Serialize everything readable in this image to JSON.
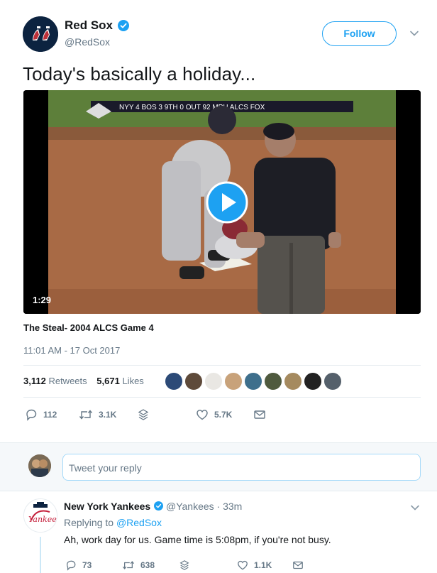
{
  "account": {
    "display_name": "Red Sox",
    "handle": "@RedSox",
    "follow_label": "Follow"
  },
  "tweet": {
    "text": "Today's basically a holiday...",
    "video": {
      "duration": "1:29",
      "scorebug": "NYY 4 BOS 3 9TH 0 OUT 92 MPH ALCS FOX",
      "title": "The Steal- 2004 ALCS Game 4"
    },
    "timestamp": "11:01 AM - 17 Oct 2017",
    "stats": {
      "retweets_count": "3,112",
      "retweets_label": "Retweets",
      "likes_count": "5,671",
      "likes_label": "Likes"
    },
    "actions": {
      "replies": "112",
      "retweets": "3.1K",
      "likes": "5.7K"
    }
  },
  "composer": {
    "placeholder": "Tweet your reply"
  },
  "reply": {
    "name": "New York Yankees",
    "handle": "@Yankees",
    "time": "33m",
    "replying_prefix": "Replying to",
    "replying_to": "@RedSox",
    "text": "Ah, work day for us. Game time is 5:08pm, if you're not busy.",
    "actions": {
      "replies": "73",
      "retweets": "638",
      "likes": "1.1K"
    }
  },
  "colors": {
    "accent": "#1da1f2",
    "muted": "#657786",
    "text": "#14171a"
  }
}
